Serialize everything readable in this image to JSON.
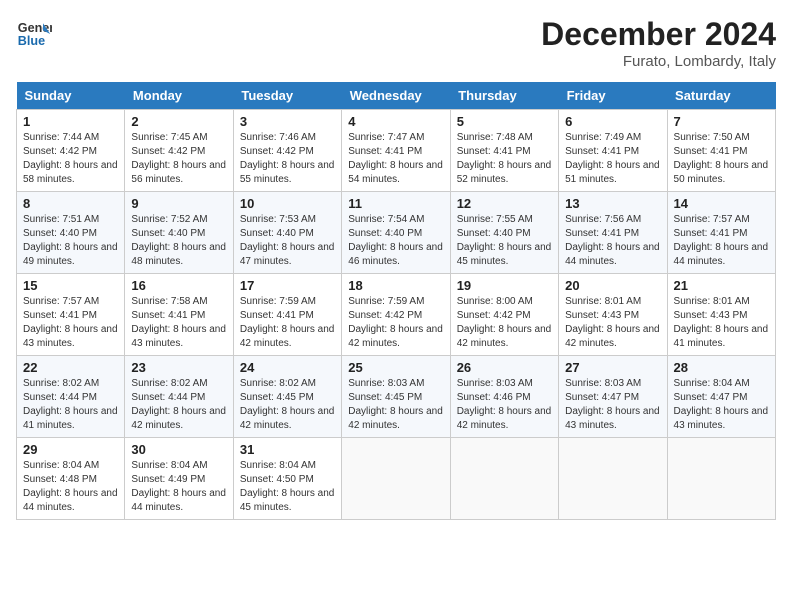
{
  "header": {
    "logo_line1": "General",
    "logo_line2": "Blue",
    "month_title": "December 2024",
    "location": "Furato, Lombardy, Italy"
  },
  "weekdays": [
    "Sunday",
    "Monday",
    "Tuesday",
    "Wednesday",
    "Thursday",
    "Friday",
    "Saturday"
  ],
  "weeks": [
    [
      {
        "day": "1",
        "sunrise": "7:44 AM",
        "sunset": "4:42 PM",
        "daylight": "8 hours and 58 minutes."
      },
      {
        "day": "2",
        "sunrise": "7:45 AM",
        "sunset": "4:42 PM",
        "daylight": "8 hours and 56 minutes."
      },
      {
        "day": "3",
        "sunrise": "7:46 AM",
        "sunset": "4:42 PM",
        "daylight": "8 hours and 55 minutes."
      },
      {
        "day": "4",
        "sunrise": "7:47 AM",
        "sunset": "4:41 PM",
        "daylight": "8 hours and 54 minutes."
      },
      {
        "day": "5",
        "sunrise": "7:48 AM",
        "sunset": "4:41 PM",
        "daylight": "8 hours and 52 minutes."
      },
      {
        "day": "6",
        "sunrise": "7:49 AM",
        "sunset": "4:41 PM",
        "daylight": "8 hours and 51 minutes."
      },
      {
        "day": "7",
        "sunrise": "7:50 AM",
        "sunset": "4:41 PM",
        "daylight": "8 hours and 50 minutes."
      }
    ],
    [
      {
        "day": "8",
        "sunrise": "7:51 AM",
        "sunset": "4:40 PM",
        "daylight": "8 hours and 49 minutes."
      },
      {
        "day": "9",
        "sunrise": "7:52 AM",
        "sunset": "4:40 PM",
        "daylight": "8 hours and 48 minutes."
      },
      {
        "day": "10",
        "sunrise": "7:53 AM",
        "sunset": "4:40 PM",
        "daylight": "8 hours and 47 minutes."
      },
      {
        "day": "11",
        "sunrise": "7:54 AM",
        "sunset": "4:40 PM",
        "daylight": "8 hours and 46 minutes."
      },
      {
        "day": "12",
        "sunrise": "7:55 AM",
        "sunset": "4:40 PM",
        "daylight": "8 hours and 45 minutes."
      },
      {
        "day": "13",
        "sunrise": "7:56 AM",
        "sunset": "4:41 PM",
        "daylight": "8 hours and 44 minutes."
      },
      {
        "day": "14",
        "sunrise": "7:57 AM",
        "sunset": "4:41 PM",
        "daylight": "8 hours and 44 minutes."
      }
    ],
    [
      {
        "day": "15",
        "sunrise": "7:57 AM",
        "sunset": "4:41 PM",
        "daylight": "8 hours and 43 minutes."
      },
      {
        "day": "16",
        "sunrise": "7:58 AM",
        "sunset": "4:41 PM",
        "daylight": "8 hours and 43 minutes."
      },
      {
        "day": "17",
        "sunrise": "7:59 AM",
        "sunset": "4:41 PM",
        "daylight": "8 hours and 42 minutes."
      },
      {
        "day": "18",
        "sunrise": "7:59 AM",
        "sunset": "4:42 PM",
        "daylight": "8 hours and 42 minutes."
      },
      {
        "day": "19",
        "sunrise": "8:00 AM",
        "sunset": "4:42 PM",
        "daylight": "8 hours and 42 minutes."
      },
      {
        "day": "20",
        "sunrise": "8:01 AM",
        "sunset": "4:43 PM",
        "daylight": "8 hours and 42 minutes."
      },
      {
        "day": "21",
        "sunrise": "8:01 AM",
        "sunset": "4:43 PM",
        "daylight": "8 hours and 41 minutes."
      }
    ],
    [
      {
        "day": "22",
        "sunrise": "8:02 AM",
        "sunset": "4:44 PM",
        "daylight": "8 hours and 41 minutes."
      },
      {
        "day": "23",
        "sunrise": "8:02 AM",
        "sunset": "4:44 PM",
        "daylight": "8 hours and 42 minutes."
      },
      {
        "day": "24",
        "sunrise": "8:02 AM",
        "sunset": "4:45 PM",
        "daylight": "8 hours and 42 minutes."
      },
      {
        "day": "25",
        "sunrise": "8:03 AM",
        "sunset": "4:45 PM",
        "daylight": "8 hours and 42 minutes."
      },
      {
        "day": "26",
        "sunrise": "8:03 AM",
        "sunset": "4:46 PM",
        "daylight": "8 hours and 42 minutes."
      },
      {
        "day": "27",
        "sunrise": "8:03 AM",
        "sunset": "4:47 PM",
        "daylight": "8 hours and 43 minutes."
      },
      {
        "day": "28",
        "sunrise": "8:04 AM",
        "sunset": "4:47 PM",
        "daylight": "8 hours and 43 minutes."
      }
    ],
    [
      {
        "day": "29",
        "sunrise": "8:04 AM",
        "sunset": "4:48 PM",
        "daylight": "8 hours and 44 minutes."
      },
      {
        "day": "30",
        "sunrise": "8:04 AM",
        "sunset": "4:49 PM",
        "daylight": "8 hours and 44 minutes."
      },
      {
        "day": "31",
        "sunrise": "8:04 AM",
        "sunset": "4:50 PM",
        "daylight": "8 hours and 45 minutes."
      },
      null,
      null,
      null,
      null
    ]
  ],
  "labels": {
    "sunrise": "Sunrise:",
    "sunset": "Sunset:",
    "daylight": "Daylight:"
  }
}
